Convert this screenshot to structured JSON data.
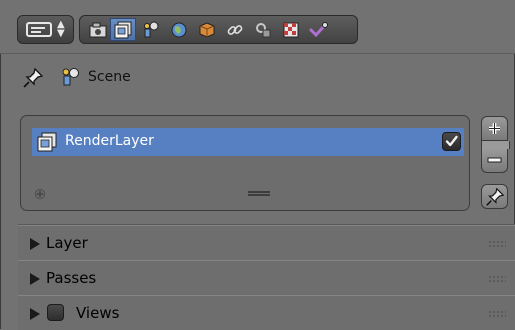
{
  "header": {
    "editor_type_icon": "properties-editor-icon",
    "context_tabs": [
      {
        "icon": "render-icon",
        "active": false
      },
      {
        "icon": "render-layers-icon",
        "active": true
      },
      {
        "icon": "scene-icon",
        "active": false
      },
      {
        "icon": "world-icon",
        "active": false
      },
      {
        "icon": "object-icon",
        "active": false
      },
      {
        "icon": "constraints-icon",
        "active": false
      },
      {
        "icon": "modifiers-icon",
        "active": false
      },
      {
        "icon": "texture-icon",
        "active": false
      },
      {
        "icon": "data-icon",
        "active": false
      }
    ]
  },
  "scene": {
    "label": "Scene"
  },
  "render_layers": {
    "items": [
      {
        "label": "RenderLayer",
        "enabled": true
      }
    ],
    "add_button": "+",
    "remove_button": "−"
  },
  "panels": [
    {
      "label": "Layer",
      "collapsed": true
    },
    {
      "label": "Passes",
      "collapsed": true
    },
    {
      "label": "Views",
      "collapsed": true,
      "has_checkbox": true
    }
  ],
  "colors": {
    "background": "#727272",
    "selection": "#5680c2",
    "accent": "#4d72aa"
  }
}
